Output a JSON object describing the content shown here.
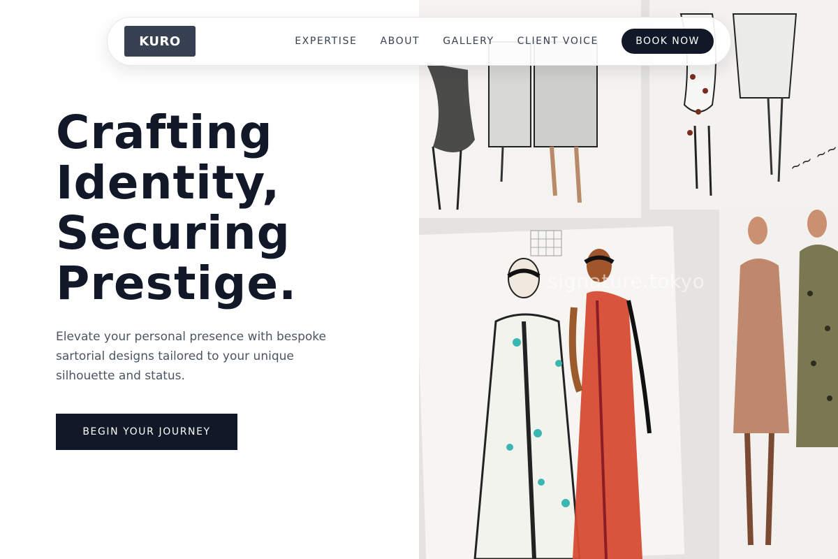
{
  "brand": {
    "logo": "KURO"
  },
  "nav": {
    "links": [
      "EXPERTISE",
      "ABOUT",
      "GALLERY",
      "CLIENT VOICE"
    ],
    "cta": "BOOK NOW"
  },
  "hero": {
    "title_lines": [
      "Crafting",
      "Identity,",
      "Securing",
      "Prestige."
    ],
    "subtitle": "Elevate your personal presence with bespoke sartorial designs tailored to your unique silhouette and status.",
    "cta": "BEGIN YOUR JOURNEY"
  },
  "artwork": {
    "watermark": "signature.tokyo"
  },
  "colors": {
    "primary": "#111827",
    "logo_bg": "#374151",
    "text_muted": "#4b5563"
  }
}
